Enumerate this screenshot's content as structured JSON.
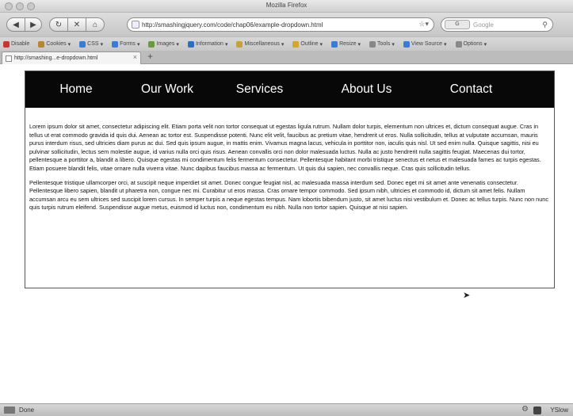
{
  "window": {
    "title": "Mozilla Firefox",
    "back_icon": "back-arrow-icon",
    "forward_icon": "forward-arrow-icon",
    "reload_icon": "reload-icon",
    "stop_icon": "stop-icon",
    "home_icon": "home-icon"
  },
  "nav": {
    "url": "http://smashingjquery.com/code/chap06/example-dropdown.html",
    "search_placeholder": "Google",
    "search_engine": "G"
  },
  "devbar": {
    "items": [
      {
        "label": "Disable",
        "color": "#c33"
      },
      {
        "label": "Cookies",
        "color": "#b8862e"
      },
      {
        "label": "CSS",
        "color": "#3a7bd5"
      },
      {
        "label": "Forms",
        "color": "#3a7bd5"
      },
      {
        "label": "Images",
        "color": "#6a9b3a"
      },
      {
        "label": "Information",
        "color": "#2b6fc2"
      },
      {
        "label": "Miscellaneous",
        "color": "#c6a23a"
      },
      {
        "label": "Outline",
        "color": "#d4a62a"
      },
      {
        "label": "Resize",
        "color": "#3a7bd5"
      },
      {
        "label": "Tools",
        "color": "#888"
      },
      {
        "label": "View Source",
        "color": "#3a7bd5"
      },
      {
        "label": "Options",
        "color": "#888"
      }
    ]
  },
  "tabs": [
    {
      "label": "http://smashing...e-dropdown.html"
    }
  ],
  "site": {
    "nav": [
      {
        "label": "Home"
      },
      {
        "label": "Our Work"
      },
      {
        "label": "Services"
      },
      {
        "label": "About Us"
      },
      {
        "label": "Contact"
      }
    ],
    "paragraphs": [
      "Lorem ipsum dolor sit amet, consectetur adipiscing elit. Etiam porta velit non tortor consequat ut egestas ligula rutrum. Nullam dolor turpis, elementum non ultrices et, dictum consequat augue. Cras in tellus ut erat commodo gravida id quis dui. Aenean ac tortor est. Suspendisse potenti. Nunc elit velit, faucibus ac pretium vitae, hendrerit ut eros. Nulla sollicitudin, tellus at vulputate accumsan, mauris purus interdum risus, sed ultricies diam purus ac dui. Sed quis ipsum augue, in mattis enim. Vivamus magna lacus, vehicula in porttitor non, iaculis quis nisl. Ut sed enim nulla. Quisque sagittis, nisi eu pulvinar sollicitudin, lectus sem molestie augue, id varius nulla orci quis risus. Aenean convallis orci non dolor malesuada luctus. Nulla ac justo hendrerit nulla sagittis feugiat. Maecenas dui tortor, pellentesque a porttitor a, blandit a libero. Quisque egestas mi condimentum felis fermentum consectetur. Pellentesque habitant morbi tristique senectus et netus et malesuada fames ac turpis egestas. Etiam posuere blandit felis, vitae ornare nulla viverra vitae. Nunc dapibus faucibus massa ac fermentum. Ut quis dui sapien, nec convallis neque. Cras quis sollicitudin tellus.",
      "Pellentesque tristique ullamcorper orci, at suscipit neque imperdiet sit amet. Donec congue feugiat nisl, ac malesuada massa interdum sed. Donec eget mi sit amet ante venenatis consectetur. Pellentesque libero sapien, blandit ut pharetra non, congue nec mi. Curabitur ut eros massa. Cras ornare tempor commodo. Sed ipsum nibh, ultricies et commodo id, dictum sit amet felis. Nullam accumsan arcu eu sem ultrices sed suscipit lorem cursus. In semper turpis a neque egestas tempus. Nam lobortis bibendum justo, sit amet luctus nisi vestibulum et. Donec ac tellus turpis. Nunc non nunc quis turpis rutrum eleifend. Suspendisse augue metus, euismod id luctus non, condimentum eu nibh. Nulla non tortor sapien. Quisque at nisi sapien."
    ]
  },
  "status": {
    "text": "Done",
    "yslow": "YSlow"
  }
}
